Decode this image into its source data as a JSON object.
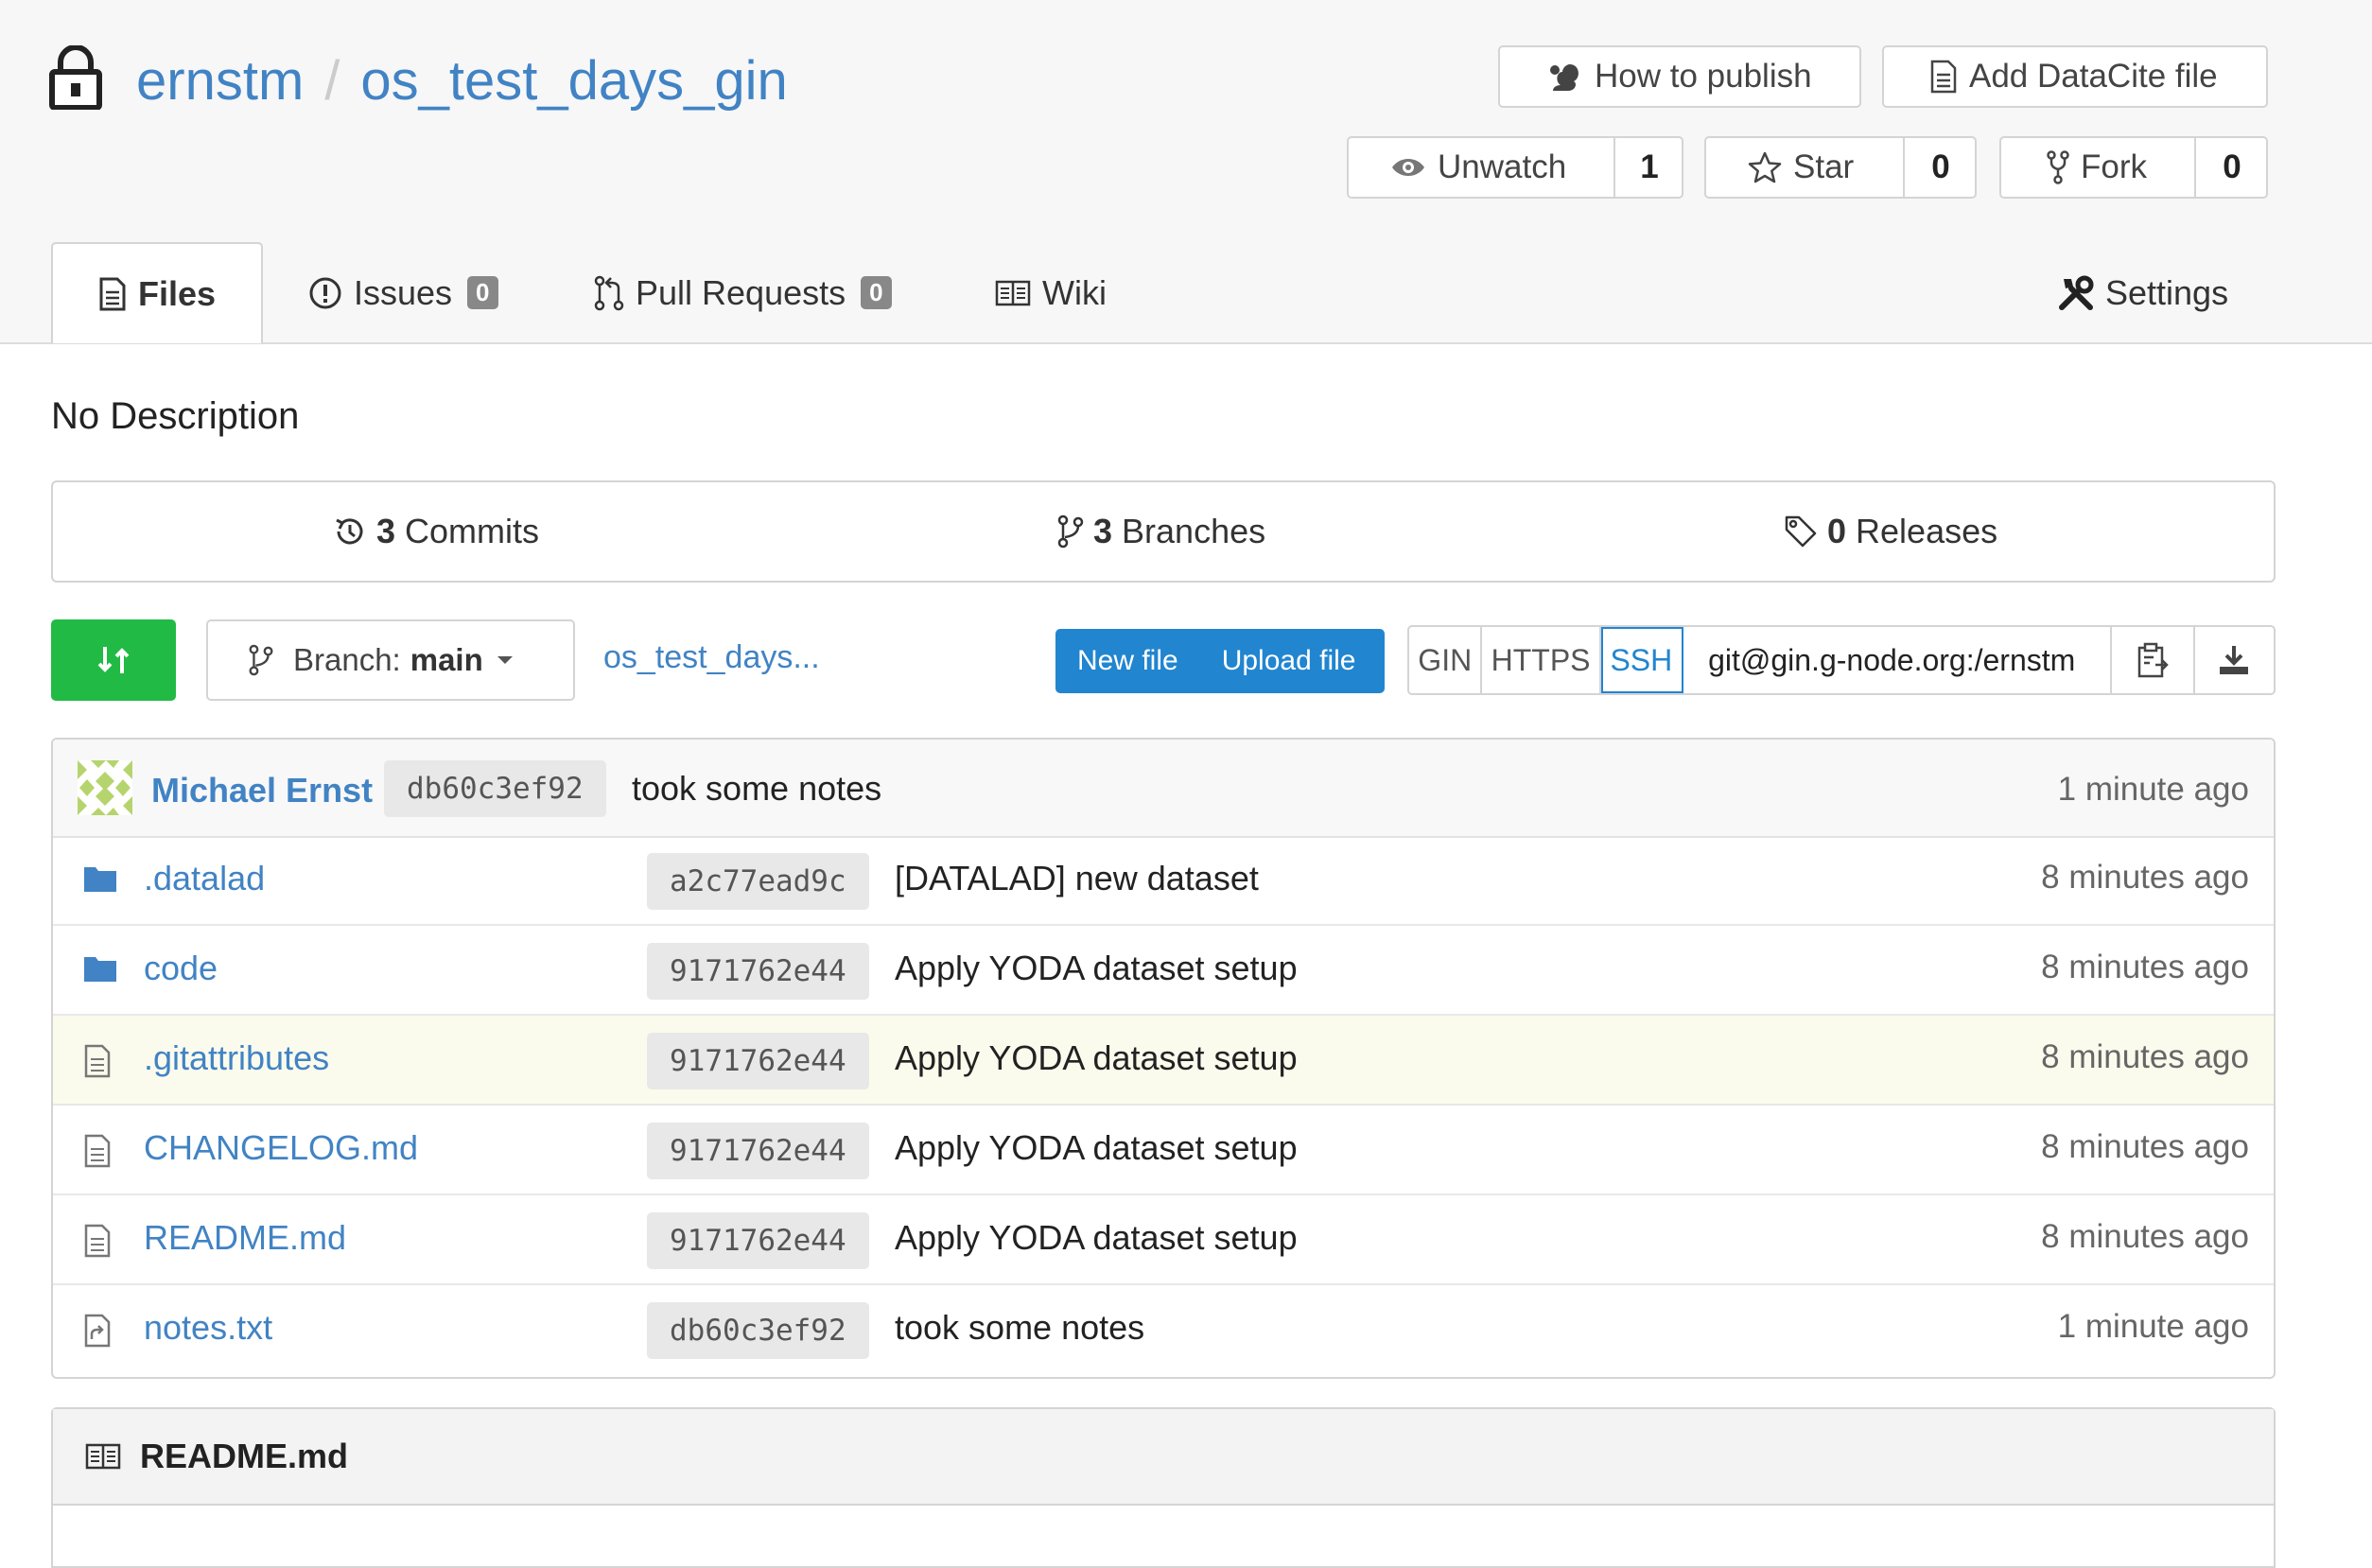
{
  "repo": {
    "owner": "ernstm",
    "separator": "/",
    "name": "os_test_days_gin"
  },
  "header_buttons": {
    "how_to_publish": "How to publish",
    "add_datacite": "Add DataCite file",
    "unwatch": "Unwatch",
    "unwatch_count": "1",
    "star": "Star",
    "star_count": "0",
    "fork": "Fork",
    "fork_count": "0"
  },
  "tabs": {
    "files": "Files",
    "issues": "Issues",
    "issues_count": "0",
    "pulls": "Pull Requests",
    "pulls_count": "0",
    "wiki": "Wiki",
    "settings": "Settings"
  },
  "description": "No Description",
  "stats": {
    "commits_count": "3",
    "commits_label": "Commits",
    "branches_count": "3",
    "branches_label": "Branches",
    "releases_count": "0",
    "releases_label": "Releases"
  },
  "toolbar": {
    "branch_label": "Branch:",
    "branch_value": "main",
    "tree_path": "os_test_days...",
    "new_file": "New file",
    "upload_file": "Upload file",
    "clone_gin": "GIN",
    "clone_https": "HTTPS",
    "clone_ssh": "SSH",
    "clone_url": "git@gin.g-node.org:/ernstm"
  },
  "latest_commit": {
    "author": "Michael Ernst",
    "sha": "db60c3ef92",
    "message": "took some notes",
    "time": "1 minute ago"
  },
  "files": [
    {
      "name": ".datalad",
      "type": "folder",
      "sha": "a2c77ead9c",
      "message": "[DATALAD] new dataset",
      "time": "8 minutes ago"
    },
    {
      "name": "code",
      "type": "folder",
      "sha": "9171762e44",
      "message": "Apply YODA dataset setup",
      "time": "8 minutes ago"
    },
    {
      "name": ".gitattributes",
      "type": "file",
      "sha": "9171762e44",
      "message": "Apply YODA dataset setup",
      "time": "8 minutes ago"
    },
    {
      "name": "CHANGELOG.md",
      "type": "file",
      "sha": "9171762e44",
      "message": "Apply YODA dataset setup",
      "time": "8 minutes ago"
    },
    {
      "name": "README.md",
      "type": "file",
      "sha": "9171762e44",
      "message": "Apply YODA dataset setup",
      "time": "8 minutes ago"
    },
    {
      "name": "notes.txt",
      "type": "symlink",
      "sha": "db60c3ef92",
      "message": "took some notes",
      "time": "1 minute ago"
    }
  ],
  "readme": {
    "title": "README.md"
  },
  "colors": {
    "link": "#4183c4",
    "primary": "#2185d0",
    "green": "#21ba45",
    "highlight_row": "#fbfbed"
  }
}
